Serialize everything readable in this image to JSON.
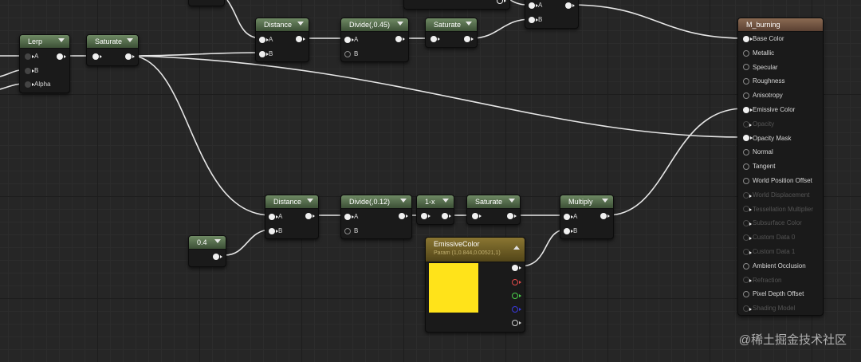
{
  "nodes": {
    "lerp": {
      "title": "Lerp",
      "pins": [
        "A",
        "B",
        "Alpha"
      ]
    },
    "saturate_top": {
      "title": "Saturate"
    },
    "distance_top": {
      "title": "Distance",
      "pins": [
        "A",
        "B"
      ]
    },
    "divide_top": {
      "title": "Divide(,0.45)",
      "pins": [
        "A",
        "B"
      ]
    },
    "saturate_top2": {
      "title": "Saturate"
    },
    "mix_top": {
      "pins": [
        "A",
        "B"
      ]
    },
    "distance_bottom": {
      "title": "Distance",
      "pins": [
        "A",
        "B"
      ]
    },
    "divide_bottom": {
      "title": "Divide(,0.12)",
      "pins": [
        "A",
        "B"
      ]
    },
    "one_minus": {
      "title": "1-x"
    },
    "saturate_bottom": {
      "title": "Saturate"
    },
    "multiply": {
      "title": "Multiply",
      "pins": [
        "A",
        "B"
      ]
    },
    "constant": {
      "title": "0.4"
    },
    "emissive_param": {
      "title": "EmissiveColor",
      "subtitle": "Param (1,0.844,0.00521,1)",
      "swatch_color": "#ffe31a"
    },
    "material": {
      "title": "M_burning",
      "pins": [
        {
          "label": "Base Color",
          "active": true,
          "connected": true
        },
        {
          "label": "Metallic",
          "active": true,
          "connected": false
        },
        {
          "label": "Specular",
          "active": true,
          "connected": false
        },
        {
          "label": "Roughness",
          "active": true,
          "connected": false
        },
        {
          "label": "Anisotropy",
          "active": true,
          "connected": false
        },
        {
          "label": "Emissive Color",
          "active": true,
          "connected": true
        },
        {
          "label": "Opacity",
          "active": false,
          "connected": false
        },
        {
          "label": "Opacity Mask",
          "active": true,
          "connected": true
        },
        {
          "label": "Normal",
          "active": true,
          "connected": false
        },
        {
          "label": "Tangent",
          "active": true,
          "connected": false
        },
        {
          "label": "World Position Offset",
          "active": true,
          "connected": false
        },
        {
          "label": "World Displacement",
          "active": false,
          "connected": false
        },
        {
          "label": "Tessellation Multiplier",
          "active": false,
          "connected": false
        },
        {
          "label": "Subsurface Color",
          "active": false,
          "connected": false
        },
        {
          "label": "Custom Data 0",
          "active": false,
          "connected": false
        },
        {
          "label": "Custom Data 1",
          "active": false,
          "connected": false
        },
        {
          "label": "Ambient Occlusion",
          "active": true,
          "connected": false
        },
        {
          "label": "Refraction",
          "active": false,
          "connected": false
        },
        {
          "label": "Pixel Depth Offset",
          "active": true,
          "connected": false
        },
        {
          "label": "Shading Model",
          "active": false,
          "connected": false
        }
      ]
    }
  },
  "watermark": "@稀土掘金技术社区",
  "colors": {
    "node_header": "#4f6a47",
    "material_header": "#7a5a46",
    "param_header": "#7a6828",
    "wire": "#e8e8e8"
  }
}
